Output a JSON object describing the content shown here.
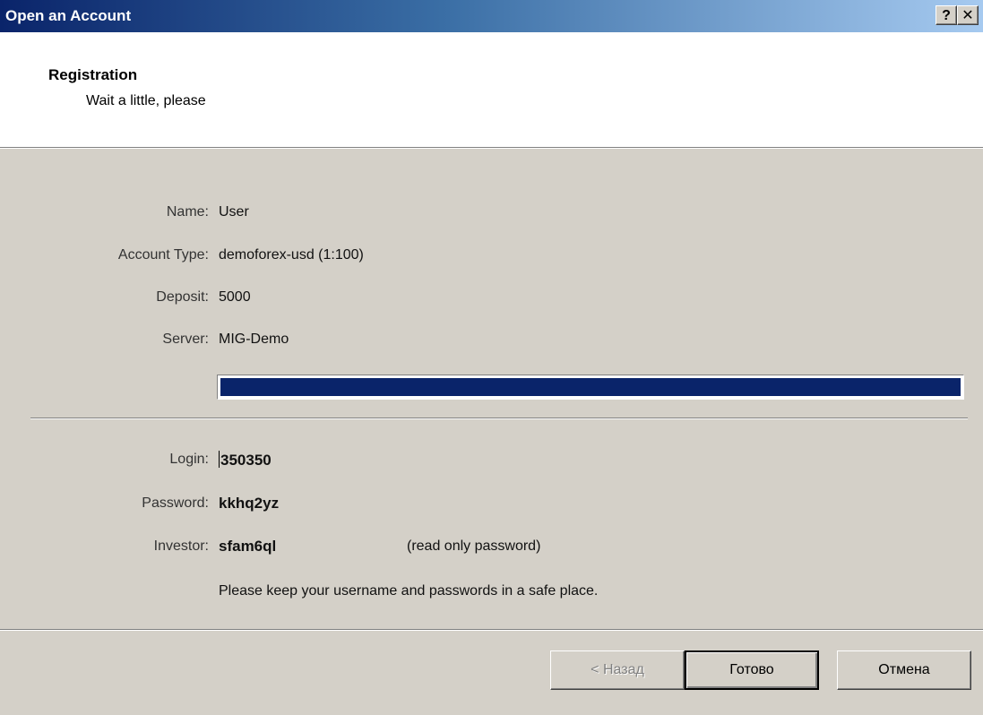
{
  "window": {
    "title": "Open an Account",
    "help_button": "?",
    "close_button": "✕"
  },
  "header": {
    "title": "Registration",
    "subtitle": "Wait a little, please"
  },
  "details": {
    "name_label": "Name:",
    "name_value": "User",
    "account_type_label": "Account Type:",
    "account_type_value": "demoforex-usd (1:100)",
    "deposit_label": "Deposit:",
    "deposit_value": "5000",
    "server_label": "Server:",
    "server_value": "MIG-Demo",
    "progress_fraction": 1.0
  },
  "credentials": {
    "login_label": "Login:",
    "login_value": "350350",
    "password_label": "Password:",
    "password_value": "kkhq2yz",
    "investor_label": "Investor:",
    "investor_value": "sfam6ql",
    "investor_note": "(read only password)",
    "notice": "Please keep your username and passwords in a safe place."
  },
  "buttons": {
    "back_label": "< Назад",
    "finish_label": "Готово",
    "cancel_label": "Отмена"
  }
}
